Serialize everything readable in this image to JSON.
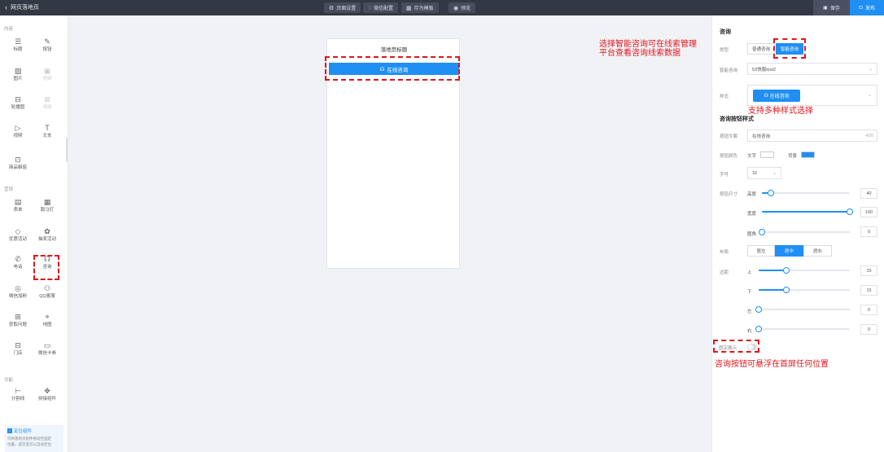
{
  "topbar": {
    "back_label": "网页落地页",
    "tools": [
      {
        "icon": "gear-icon",
        "label": "页面设置"
      },
      {
        "icon": "wechat-icon",
        "label": "微信配置"
      },
      {
        "icon": "template-icon",
        "label": "存为模板"
      },
      {
        "icon": "eye-icon",
        "label": "预览"
      }
    ],
    "save_label": "保存",
    "publish_label": "发布"
  },
  "sidebar": {
    "sections": [
      {
        "title": "内容"
      },
      {
        "title": "营销"
      },
      {
        "title": "功能"
      }
    ],
    "items": [
      {
        "label": "标题",
        "icon": "title-icon",
        "glyph": "☰"
      },
      {
        "label": "按钮",
        "icon": "pen-icon",
        "glyph": "✎"
      },
      {
        "label": "图片",
        "icon": "image-icon",
        "glyph": "▨"
      },
      {
        "label": "视频",
        "icon": "video-icon",
        "glyph": "▣"
      },
      {
        "label": "轮播图",
        "icon": "carousel-icon",
        "glyph": "⊟"
      },
      {
        "label": "视频",
        "icon": "link-icon",
        "glyph": "⊠"
      },
      {
        "label": "视频",
        "icon": "play-icon",
        "glyph": "▷"
      },
      {
        "label": "文本",
        "icon": "text-icon",
        "glyph": "T"
      },
      {
        "label": "商品橱窗",
        "icon": "shop-icon",
        "glyph": "⊡"
      },
      {
        "label": "表单",
        "icon": "form-icon",
        "glyph": "▤"
      },
      {
        "label": "跑马灯",
        "icon": "marquee-icon",
        "glyph": "▦"
      },
      {
        "label": "优惠活动",
        "icon": "coupon-icon",
        "glyph": "◇"
      },
      {
        "label": "抽奖活动",
        "icon": "lottery-icon",
        "glyph": "✿"
      },
      {
        "label": "电话",
        "icon": "phone-icon",
        "glyph": "✆"
      },
      {
        "label": "咨询",
        "icon": "headset-icon",
        "glyph": "☊"
      },
      {
        "label": "微信加粉",
        "icon": "wechat-fan-icon",
        "glyph": "◎"
      },
      {
        "label": "QQ客服",
        "icon": "qq-icon",
        "glyph": "⚇"
      },
      {
        "label": "获取问题",
        "icon": "question-icon",
        "glyph": "⊞"
      },
      {
        "label": "地图",
        "icon": "map-pin-icon",
        "glyph": "⌖"
      },
      {
        "label": "门店",
        "icon": "store-icon",
        "glyph": "⊟"
      },
      {
        "label": "微信卡券",
        "icon": "card-icon",
        "glyph": "▭"
      },
      {
        "label": "分割线",
        "icon": "divider-icon",
        "glyph": "⊢"
      },
      {
        "label": "拼接组件",
        "icon": "puzzle-icon",
        "glyph": "✥"
      }
    ],
    "notice_title": "定位组件",
    "notice_body": [
      "可将落地页组件拖动至固定",
      "位置，提交后可以自动定位"
    ]
  },
  "canvas": {
    "page_title": "落地页标题",
    "consult_button": "在线咨询"
  },
  "annotations": {
    "smart_consult": [
      "选择智能咨询可在线索管理",
      "平台查看咨询线索数据"
    ],
    "styles": "支持多种样式选择",
    "float": "咨询按钮可悬浮在首屏任何位置"
  },
  "panel": {
    "section_consult": "咨询",
    "type_label": "类型",
    "type_options": [
      "普通咨询",
      "智能咨询"
    ],
    "selected_type": "智能咨询",
    "smart_label": "智能咨询",
    "smart_value": "53快服test2",
    "style_label": "样式",
    "style_preview": "在线咨询",
    "section_button_style": "咨询按钮样式",
    "btn_text_label": "按钮文案",
    "btn_text_value": "在线咨询",
    "btn_text_count": "4/20",
    "btn_color_label": "按钮颜色",
    "text_color_label": "文字",
    "bg_color_label": "背景",
    "text_color": "#ffffff",
    "bg_color": "#1f8ff3",
    "font_size_label": "字号",
    "font_size_value": "16",
    "btn_size_label": "按钮尺寸",
    "height_label": "高度",
    "height_value": "40",
    "height_level": 0.1,
    "width_label": "宽度",
    "width_value": "100",
    "width_level": 1.0,
    "radius_label": "圆角",
    "radius_value": "0",
    "radius_level": 0.0,
    "align_label": "布局",
    "align_options": [
      "居左",
      "居中",
      "居右"
    ],
    "selected_align": "居中",
    "margin_label": "边距",
    "margin_top_label": "上",
    "margin_top_value": "15",
    "margin_top_level": 0.3,
    "margin_bottom_label": "下",
    "margin_bottom_value": "15",
    "margin_bottom_level": 0.3,
    "margin_left_label": "左",
    "margin_left_value": "0",
    "margin_left_level": 0.0,
    "margin_right_label": "右",
    "margin_right_value": "0",
    "margin_right_level": 0.0,
    "float_label": "固定展示",
    "float_on": false
  },
  "colors": {
    "accent": "#1f8ff3",
    "annotation": "#e0151c",
    "topbar": "#333845"
  }
}
